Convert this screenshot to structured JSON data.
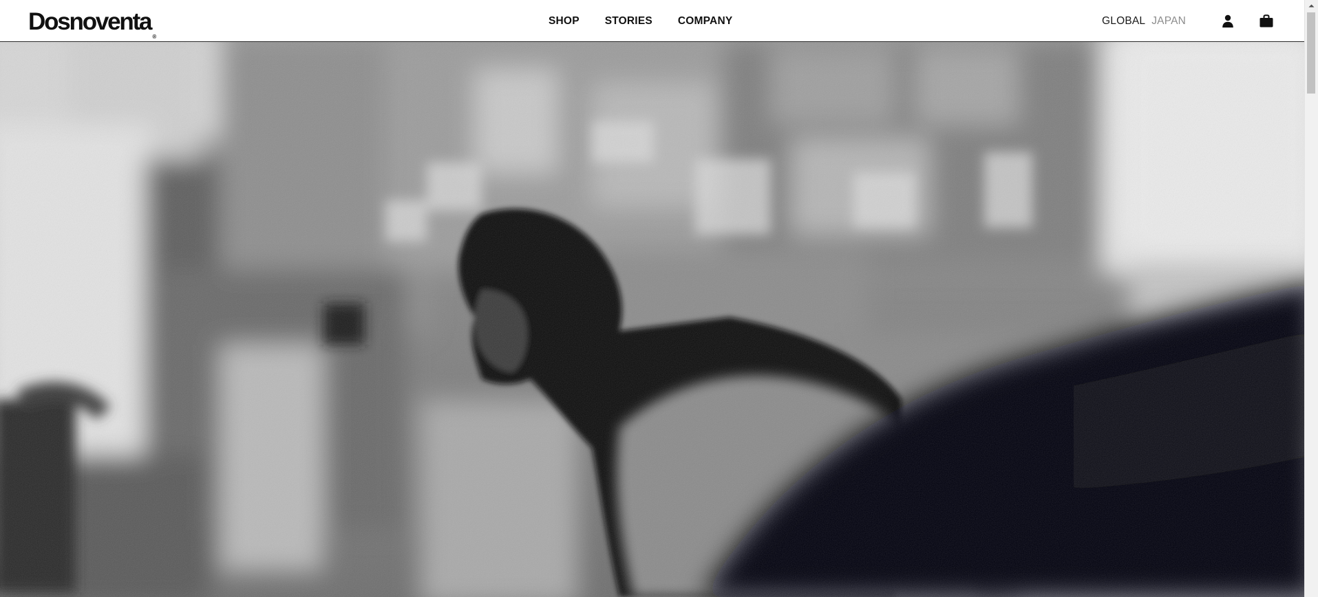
{
  "brand": {
    "name": "Dosnoventa",
    "mark": "®"
  },
  "nav": {
    "items": [
      {
        "label": "SHOP"
      },
      {
        "label": "STORIES"
      },
      {
        "label": "COMPANY"
      }
    ]
  },
  "region": {
    "active": "GLOBAL",
    "inactive": "JAPAN"
  },
  "icons": {
    "account": "user-icon",
    "cart": "shopping-bag-icon"
  },
  "hero": {
    "style": "black-and-white blurred photo",
    "colors": {
      "light": "#e6e6e6",
      "mid": "#8a8a8a",
      "dark": "#0c0c0e"
    }
  }
}
